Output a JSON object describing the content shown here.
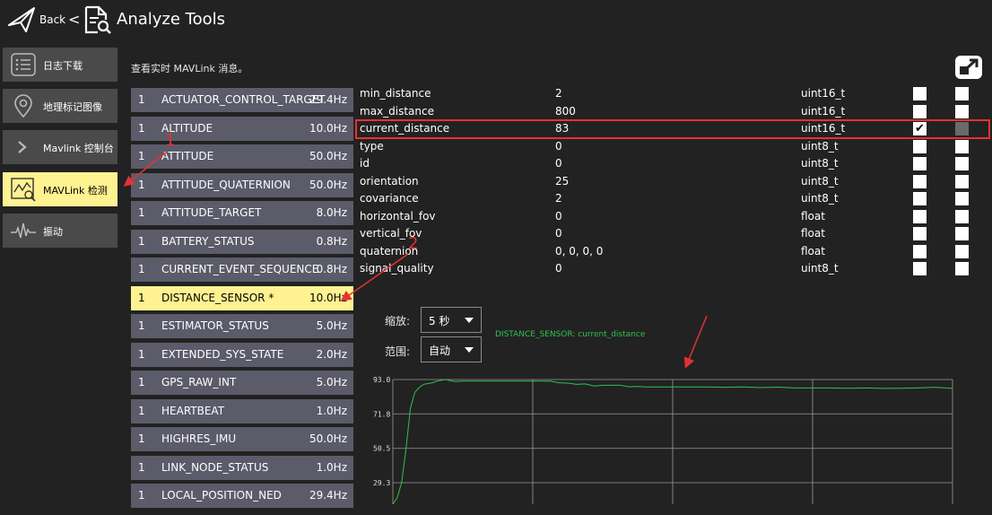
{
  "header": {
    "back_label": "Back",
    "chevron": "<",
    "title": "Analyze Tools"
  },
  "nav": [
    {
      "label": "日志下载",
      "icon": "list-icon",
      "active": false
    },
    {
      "label": "地理标记图像",
      "icon": "location-pin-icon",
      "active": false
    },
    {
      "label": "Mavlink 控制台",
      "icon": "chevron-right-icon",
      "active": false
    },
    {
      "label": "MAVLink 检测",
      "icon": "chart-inspect-icon",
      "active": true
    },
    {
      "label": "振动",
      "icon": "waveform-icon",
      "active": false
    }
  ],
  "hint": "查看实时 MAVLink 消息。",
  "messages": [
    {
      "count": "1",
      "name": "ACTUATOR_CONTROL_TARGET",
      "rate": "29.4Hz"
    },
    {
      "count": "1",
      "name": "ALTITUDE",
      "rate": "10.0Hz"
    },
    {
      "count": "1",
      "name": "ATTITUDE",
      "rate": "50.0Hz"
    },
    {
      "count": "1",
      "name": "ATTITUDE_QUATERNION",
      "rate": "50.0Hz"
    },
    {
      "count": "1",
      "name": "ATTITUDE_TARGET",
      "rate": "8.0Hz"
    },
    {
      "count": "1",
      "name": "BATTERY_STATUS",
      "rate": "0.8Hz"
    },
    {
      "count": "1",
      "name": "CURRENT_EVENT_SEQUENCE",
      "rate": "0.8Hz"
    },
    {
      "count": "1",
      "name": "DISTANCE_SENSOR *",
      "rate": "10.0Hz",
      "selected": true
    },
    {
      "count": "1",
      "name": "ESTIMATOR_STATUS",
      "rate": "5.0Hz"
    },
    {
      "count": "1",
      "name": "EXTENDED_SYS_STATE",
      "rate": "2.0Hz"
    },
    {
      "count": "1",
      "name": "GPS_RAW_INT",
      "rate": "5.0Hz"
    },
    {
      "count": "1",
      "name": "HEARTBEAT",
      "rate": "1.0Hz"
    },
    {
      "count": "1",
      "name": "HIGHRES_IMU",
      "rate": "50.0Hz"
    },
    {
      "count": "1",
      "name": "LINK_NODE_STATUS",
      "rate": "1.0Hz"
    },
    {
      "count": "1",
      "name": "LOCAL_POSITION_NED",
      "rate": "29.4Hz"
    }
  ],
  "fields": [
    {
      "name": "min_distance",
      "value": "2",
      "type": "uint16_t",
      "plot1": false,
      "plot2": false
    },
    {
      "name": "max_distance",
      "value": "800",
      "type": "uint16_t",
      "plot1": false,
      "plot2": false
    },
    {
      "name": "current_distance",
      "value": "83",
      "type": "uint16_t",
      "plot1": true,
      "plot2": false,
      "plot2_disabled": true
    },
    {
      "name": "type",
      "value": "0",
      "type": "uint8_t",
      "plot1": false,
      "plot2": false
    },
    {
      "name": "id",
      "value": "0",
      "type": "uint8_t",
      "plot1": false,
      "plot2": false
    },
    {
      "name": "orientation",
      "value": "25",
      "type": "uint8_t",
      "plot1": false,
      "plot2": false
    },
    {
      "name": "covariance",
      "value": "2",
      "type": "uint8_t",
      "plot1": false,
      "plot2": false
    },
    {
      "name": "horizontal_fov",
      "value": "0",
      "type": "float",
      "plot1": false,
      "plot2": false
    },
    {
      "name": "vertical_fov",
      "value": "0",
      "type": "float",
      "plot1": false,
      "plot2": false
    },
    {
      "name": "quaternion",
      "value": "0, 0, 0, 0",
      "type": "float",
      "plot1": false,
      "plot2": false
    },
    {
      "name": "signal_quality",
      "value": "0",
      "type": "uint8_t",
      "plot1": false,
      "plot2": false
    }
  ],
  "controls": {
    "scale_label": "缩放:",
    "scale_value": "5 秒",
    "range_label": "范围:",
    "range_value": "自动",
    "series_label": "DISTANCE_SENSOR: current_distance"
  },
  "annotations": {
    "one": "1",
    "two": "2"
  },
  "colors": {
    "accent": "#fff291",
    "series": "#2fc24f",
    "annotation": "#e53232",
    "row_bg": "#5b5b6a"
  },
  "chart_data": {
    "type": "line",
    "y_ticks": [
      "93.0",
      "71.8",
      "50.5",
      "29.3"
    ],
    "y_tick_values": [
      93.0,
      71.8,
      50.5,
      29.3
    ],
    "ylim": [
      16,
      93.0
    ],
    "grid": true,
    "series": [
      {
        "x": [
          0,
          5,
          10,
          15,
          20,
          25,
          30,
          35,
          40,
          45,
          50,
          60,
          70,
          80,
          90,
          100,
          110,
          120,
          130,
          140,
          150,
          160,
          170,
          180,
          190,
          200,
          210,
          220,
          230,
          240,
          250,
          260,
          270,
          280,
          290,
          300,
          310,
          320,
          340,
          360,
          380,
          400,
          420,
          440,
          460,
          480,
          500,
          520,
          540,
          560,
          580,
          600,
          620,
          640
        ],
        "values": [
          16,
          20,
          29.3,
          50,
          75,
          85,
          88,
          90,
          90.5,
          91,
          92,
          93,
          91.8,
          92,
          92,
          92,
          92,
          92,
          92,
          92,
          92,
          92,
          92,
          92,
          91,
          90.8,
          90,
          90.3,
          89,
          89.5,
          89.5,
          89.5,
          88.5,
          88.7,
          88.4,
          88.4,
          88.4,
          88.4,
          88.4,
          88.4,
          88.2,
          88.4,
          88,
          88.3,
          87.8,
          87.8,
          87.8,
          87.6,
          87.8,
          87.5,
          87.6,
          87.8,
          88.2,
          87.5
        ]
      }
    ]
  }
}
